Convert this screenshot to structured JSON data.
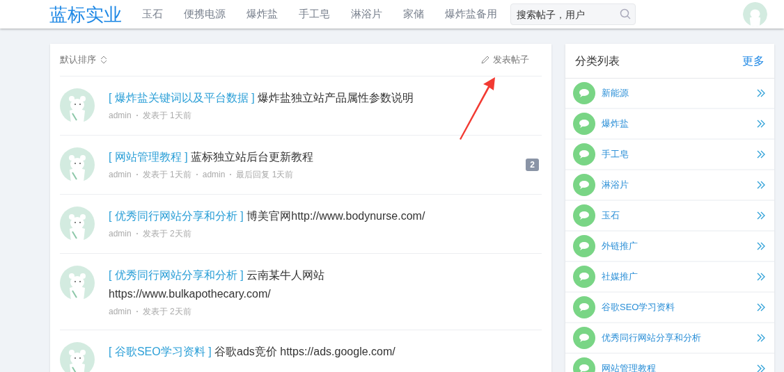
{
  "header": {
    "logo": "蓝标实业",
    "nav": [
      "玉石",
      "便携电源",
      "爆炸盐",
      "手工皂",
      "淋浴片",
      "家储",
      "爆炸盐备用"
    ],
    "search": {
      "placeholder": "搜索帖子，用户"
    }
  },
  "toolbar": {
    "sort": "默认排序",
    "new_post": "发表帖子"
  },
  "posts": [
    {
      "category": "[ 爆炸盐关键词以及平台数据 ]",
      "title": "爆炸盐独立站产品属性参数说明",
      "meta": [
        "admin",
        "发表于 1天前"
      ]
    },
    {
      "category": "[ 网站管理教程 ]",
      "title": "蓝标独立站后台更新教程",
      "meta": [
        "admin",
        "发表于 1天前",
        "admin",
        "最后回复 1天前"
      ],
      "replies": "2"
    },
    {
      "category": "[ 优秀同行网站分享和分析 ]",
      "title": "博美官网http://www.bodynurse.com/",
      "meta": [
        "admin",
        "发表于 2天前"
      ]
    },
    {
      "category": "[ 优秀同行网站分享和分析 ]",
      "title": "云南某牛人网站 https://www.bulkapothecary.com/",
      "meta": [
        "admin",
        "发表于 2天前"
      ]
    },
    {
      "category": "[ 谷歌SEO学习资料 ]",
      "title": "谷歌ads竞价 https://ads.google.com/"
    }
  ],
  "sidebar": {
    "title": "分类列表",
    "more": "更多",
    "items": [
      "新能源",
      "爆炸盐",
      "手工皂",
      "淋浴片",
      "玉石",
      "外链推广",
      "社媒推广",
      "谷歌SEO学习资料",
      "优秀同行网站分享和分析",
      "网站管理教程"
    ]
  }
}
